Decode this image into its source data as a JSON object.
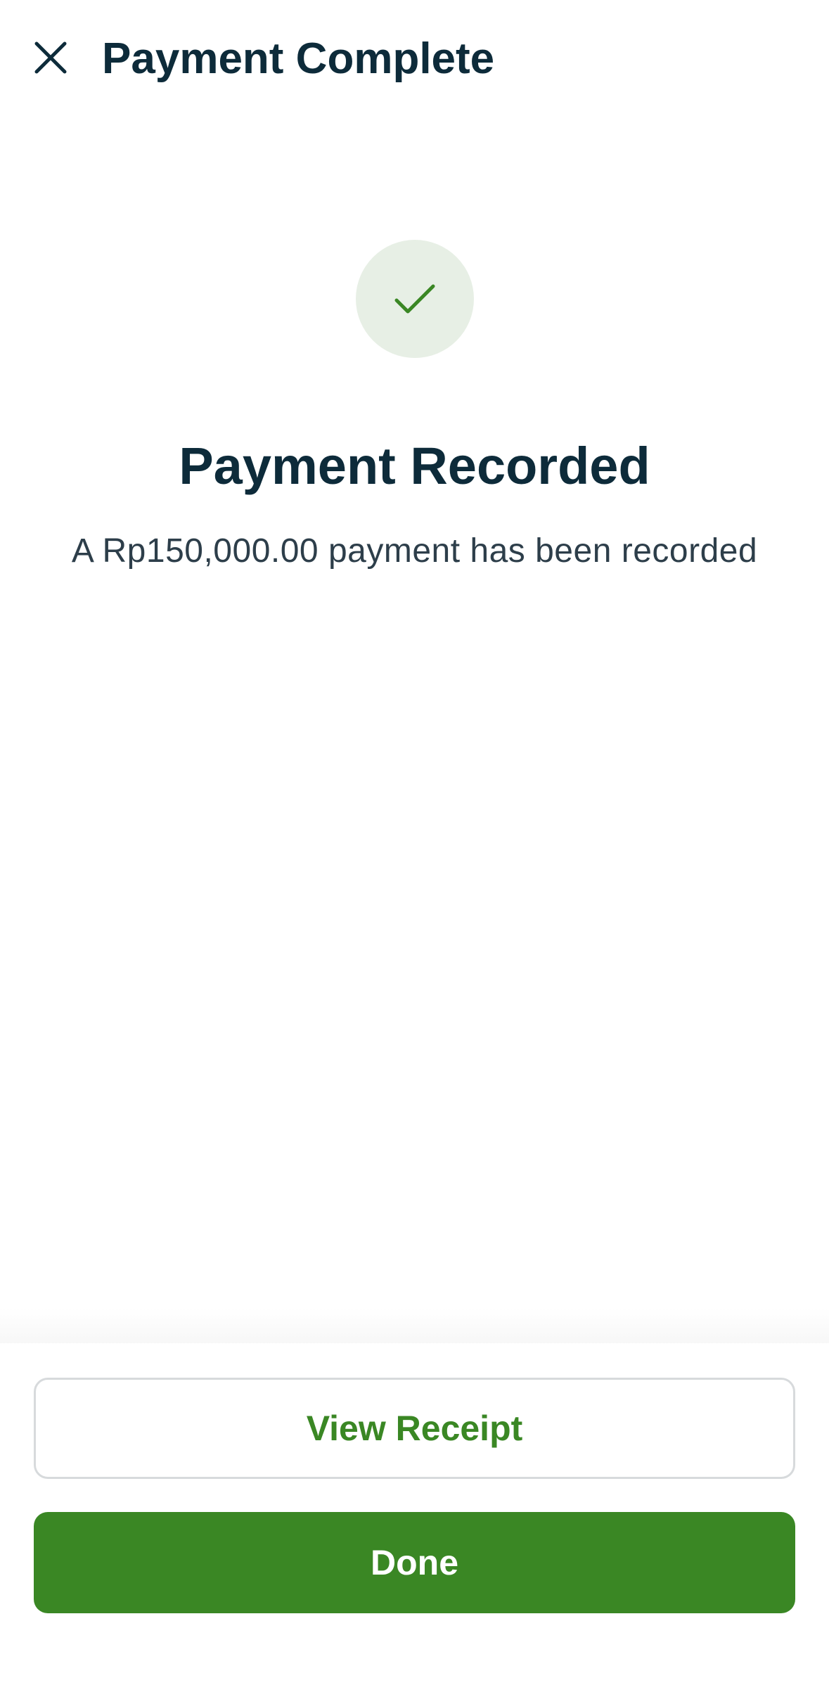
{
  "header": {
    "title": "Payment Complete",
    "close_icon": "close-icon"
  },
  "success": {
    "icon": "checkmark-icon",
    "title": "Payment Recorded",
    "message": "A Rp150,000.00 payment has been recorded"
  },
  "actions": {
    "view_receipt_label": "View Receipt",
    "done_label": "Done"
  },
  "colors": {
    "primary_green": "#3a8724",
    "success_circle_bg": "#e7efe5",
    "title_text": "#0d2b3a",
    "body_text": "#2d3e4a",
    "button_border": "#d7dadc"
  }
}
